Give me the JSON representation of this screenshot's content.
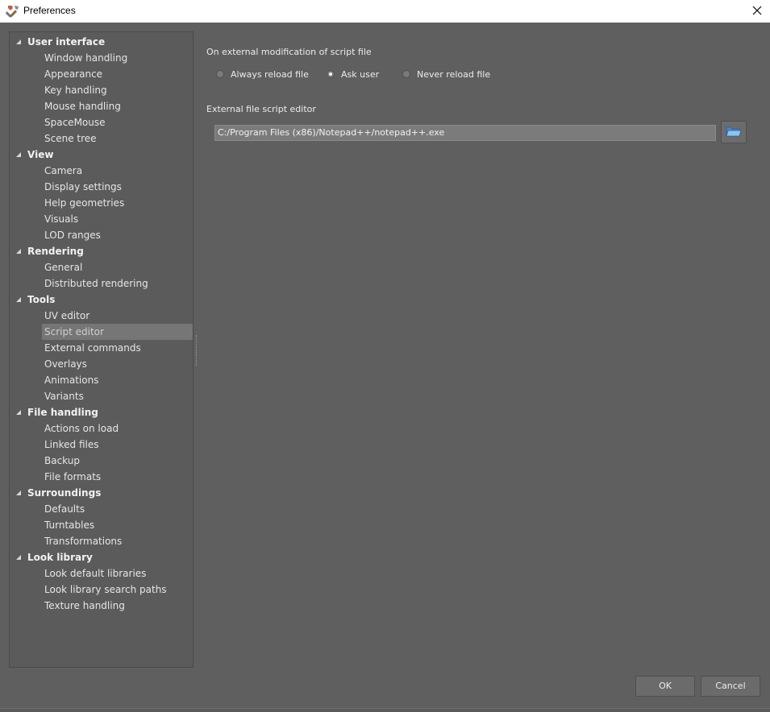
{
  "window": {
    "title": "Preferences"
  },
  "tree": {
    "categories": [
      {
        "label": "User interface",
        "items": [
          "Window handling",
          "Appearance",
          "Key handling",
          "Mouse handling",
          "SpaceMouse",
          "Scene tree"
        ]
      },
      {
        "label": "View",
        "items": [
          "Camera",
          "Display settings",
          "Help geometries",
          "Visuals",
          "LOD ranges"
        ]
      },
      {
        "label": "Rendering",
        "items": [
          "General",
          "Distributed rendering"
        ]
      },
      {
        "label": "Tools",
        "items": [
          "UV editor",
          "Script editor",
          "External commands",
          "Overlays",
          "Animations",
          "Variants"
        ]
      },
      {
        "label": "File handling",
        "items": [
          "Actions on load",
          "Linked files",
          "Backup",
          "File formats"
        ]
      },
      {
        "label": "Surroundings",
        "items": [
          "Defaults",
          "Turntables",
          "Transformations"
        ]
      },
      {
        "label": "Look library",
        "items": [
          "Look default libraries",
          "Look library search paths",
          "Texture handling"
        ]
      }
    ],
    "selected": "Script editor"
  },
  "script_editor": {
    "modification_label": "On external modification of script file",
    "radio_options": [
      {
        "label": "Always reload file",
        "checked": false
      },
      {
        "label": "Ask user",
        "checked": true
      },
      {
        "label": "Never reload file",
        "checked": false
      }
    ],
    "editor_label": "External file script editor",
    "editor_path": "C:/Program Files (x86)/Notepad++/notepad++.exe"
  },
  "buttons": {
    "ok": "OK",
    "cancel": "Cancel"
  },
  "icons": {
    "app": "tools-icon",
    "close": "close-icon",
    "browse": "folder-open-icon",
    "expand": "triangle-expanded-icon"
  }
}
